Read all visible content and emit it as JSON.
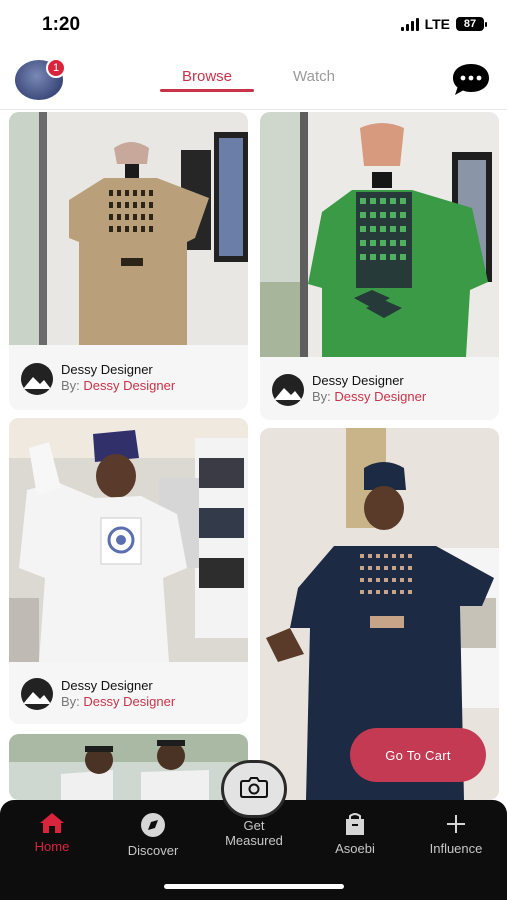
{
  "status_bar": {
    "time": "1:20",
    "network": "LTE",
    "battery": "87"
  },
  "header": {
    "notification_count": "1",
    "tabs": [
      {
        "label": "Browse",
        "active": true
      },
      {
        "label": "Watch",
        "active": false
      }
    ]
  },
  "feed": {
    "items": [
      {
        "designer": "Dessy Designer",
        "by_label": "By:",
        "by_name": "Dessy Designer",
        "garment_color": "#b9a07a"
      },
      {
        "designer": "Dessy Designer",
        "by_label": "By:",
        "by_name": "Dessy Designer",
        "garment_color": "#3a9a45"
      },
      {
        "designer": "Dessy Designer",
        "by_label": "By:",
        "by_name": "Dessy Designer",
        "garment_color": "#f4f4f4"
      },
      {
        "designer": "",
        "by_label": "",
        "by_name": "",
        "garment_color": "#1d2a44"
      },
      {
        "designer": "",
        "by_label": "",
        "by_name": "",
        "garment_color": "#f0f0f0"
      }
    ]
  },
  "cart_button": {
    "label": "Go To Cart"
  },
  "bottom_nav": {
    "items": [
      {
        "label": "Home",
        "icon": "home-icon",
        "active": true
      },
      {
        "label": "Discover",
        "icon": "compass-icon",
        "active": false
      },
      {
        "label": "Get Measured",
        "icon": "camera-icon",
        "active": false
      },
      {
        "label": "Asoebi",
        "icon": "shopping-bag-icon",
        "active": false
      },
      {
        "label": "Influence",
        "icon": "plus-icon",
        "active": false
      }
    ]
  },
  "colors": {
    "accent": "#c8334a",
    "nav_background": "#0d0d0d",
    "badge": "#d8243c"
  }
}
